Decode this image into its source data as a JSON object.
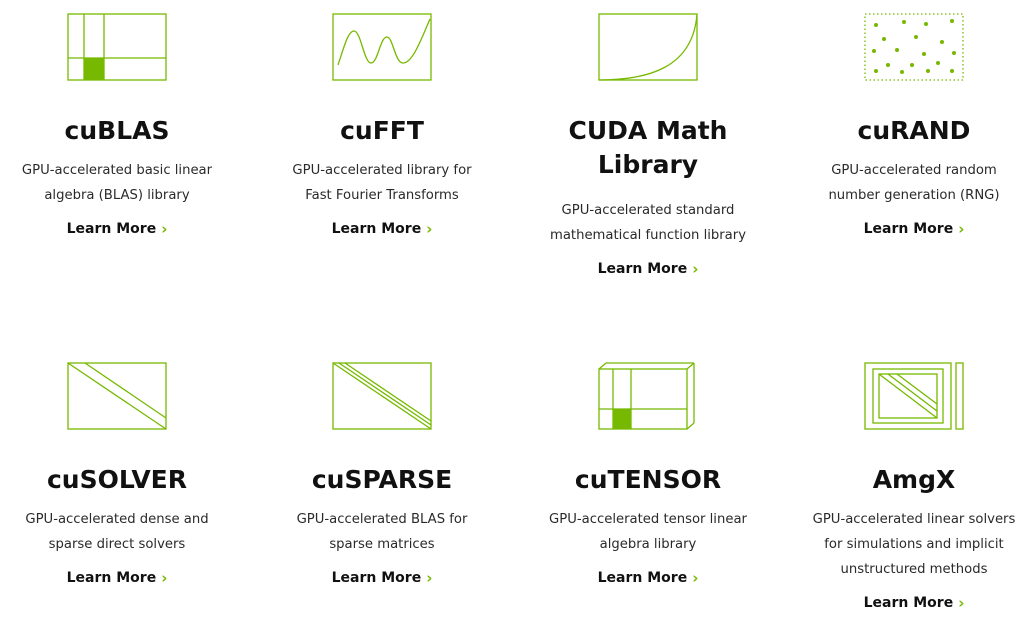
{
  "brand": {
    "accent": "#76b900",
    "text": "#1a1a1a"
  },
  "libraries": [
    {
      "name": "cuBLAS",
      "description": "GPU-accelerated basic linear\nalgebra (BLAS) library",
      "link": "Learn More",
      "icon": "matrix-grid-icon"
    },
    {
      "name": "cuFFT",
      "description": "GPU-accelerated library for\nFast Fourier Transforms",
      "link": "Learn More",
      "icon": "waveform-icon"
    },
    {
      "name": "CUDA Math\nLibrary",
      "description": "GPU-accelerated standard\nmathematical function library",
      "link": "Learn More",
      "icon": "curve-icon"
    },
    {
      "name": "cuRAND",
      "description": "GPU-accelerated random\nnumber generation (RNG)",
      "link": "Learn More",
      "icon": "random-dots-icon"
    },
    {
      "name": "cuSOLVER",
      "description": "GPU-accelerated dense and\nsparse direct solvers",
      "link": "Learn More",
      "icon": "dense-diagonal-icon"
    },
    {
      "name": "cuSPARSE",
      "description": "GPU-accelerated BLAS for\nsparse matrices",
      "link": "Learn More",
      "icon": "sparse-diagonal-icon"
    },
    {
      "name": "cuTENSOR",
      "description": "GPU-accelerated tensor linear\nalgebra library",
      "link": "Learn More",
      "icon": "tensor-cube-icon"
    },
    {
      "name": "AmgX",
      "description": "GPU-accelerated linear solvers\nfor simulations and implicit\nunstructured methods",
      "link": "Learn More",
      "icon": "nested-matrix-icon"
    }
  ]
}
